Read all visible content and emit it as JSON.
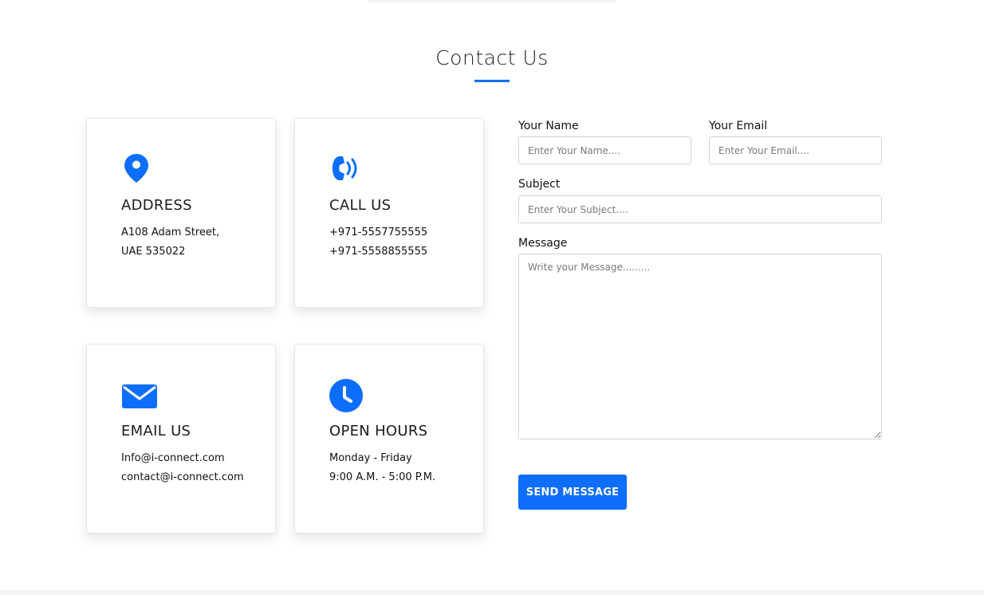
{
  "section": {
    "title": "Contact Us",
    "accent_color": "#0d6efd"
  },
  "cards": {
    "address": {
      "icon": "map-pin-icon",
      "title": "ADDRESS",
      "line1": "A108 Adam Street,",
      "line2": "UAE 535022"
    },
    "call": {
      "icon": "phone-ringing-icon",
      "title": "CALL US",
      "line1": "+971-5557755555",
      "line2": "+971-5558855555"
    },
    "email": {
      "icon": "envelope-icon",
      "title": "EMAIL US",
      "line1": "Info@i-connect.com",
      "line2": "contact@i-connect.com"
    },
    "hours": {
      "icon": "clock-icon",
      "title": "OPEN HOURS",
      "line1": "Monday - Friday",
      "line2": "9:00 A.M. - 5:00 P.M."
    }
  },
  "form": {
    "name_label": "Your Name",
    "name_placeholder": "Enter Your Name....",
    "email_label": "Your Email",
    "email_placeholder": "Enter Your Email....",
    "subject_label": "Subject",
    "subject_placeholder": "Enter Your Subject....",
    "message_label": "Message",
    "message_placeholder": "Write your Message.........",
    "submit_label": "SEND MESSAGE"
  }
}
